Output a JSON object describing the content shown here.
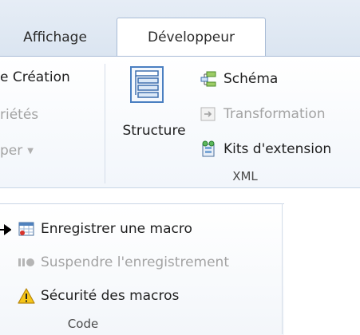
{
  "tabs": {
    "affichage": "Affichage",
    "developpeur": "Développeur"
  },
  "ribbon": {
    "partial_items": [
      "e Création",
      "riétés",
      "per"
    ],
    "xml": {
      "structure_label": "Structure",
      "schema_label": "Schéma",
      "transformation_label": "Transformation",
      "kits_label": "Kits d'extension",
      "group_label": "XML"
    }
  },
  "code": {
    "record_macro": "Enregistrer une macro",
    "pause_recording": "Suspendre l'enregistrement",
    "macro_security": "Sécurité des macros",
    "group_label": "Code"
  },
  "icons": {
    "structure": "xml-structure-icon",
    "schema": "schema-icon",
    "transformation": "transformation-icon",
    "kits": "expansion-packs-icon",
    "record": "record-macro-icon",
    "pause": "pause-recording-icon",
    "security": "warning-icon",
    "pointer": "arrow-pointer-icon"
  }
}
